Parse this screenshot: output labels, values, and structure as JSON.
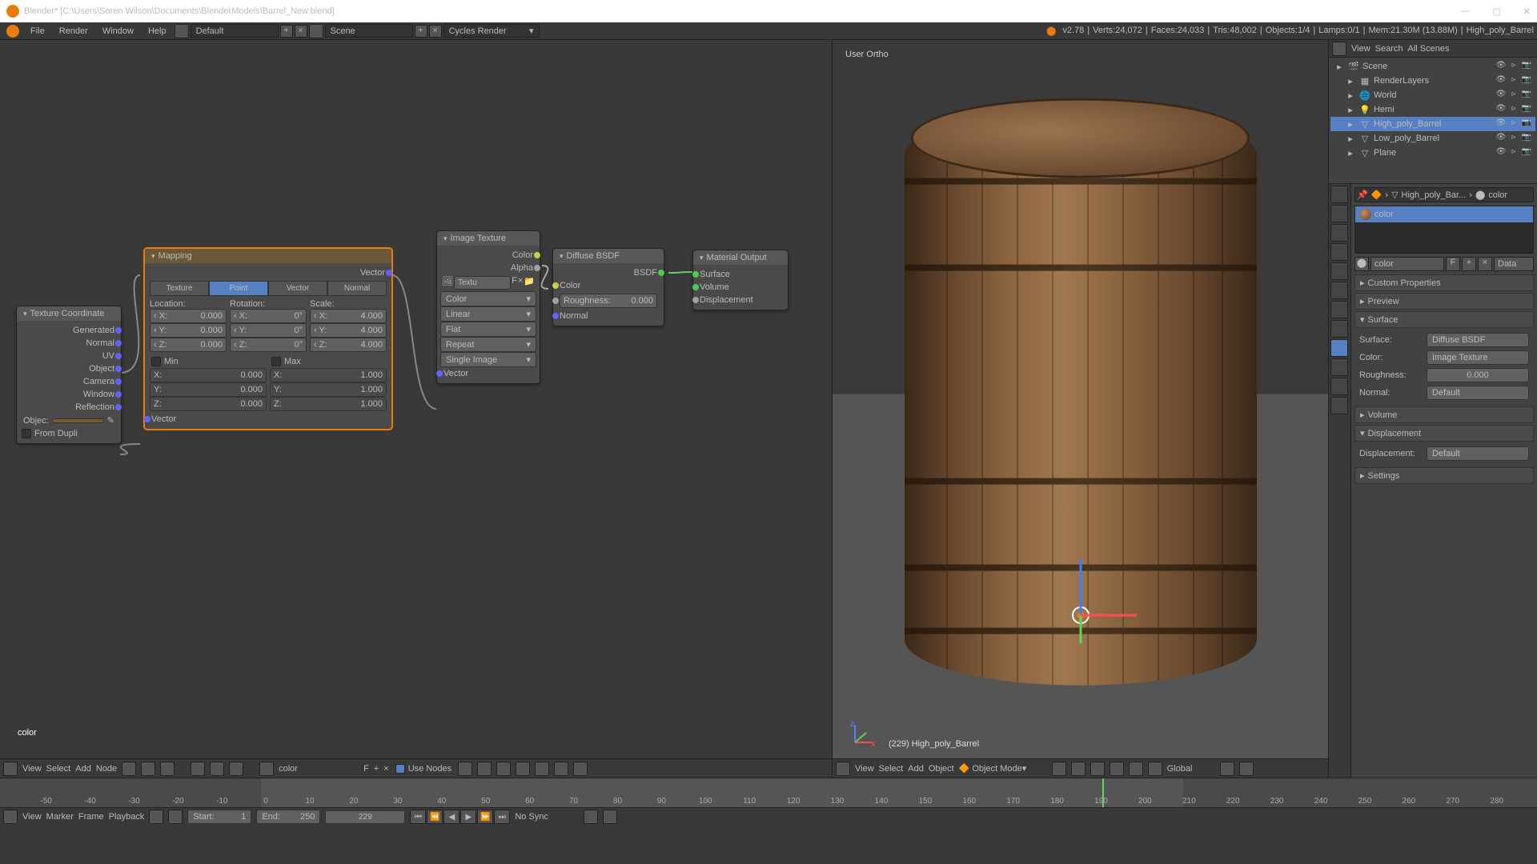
{
  "title": "Blender* [C:\\Users\\Soren Wilson\\Documents\\BlenderModels\\Barrel_New.blend]",
  "menubar": {
    "items": [
      "File",
      "Render",
      "Window",
      "Help"
    ],
    "layout": "Default",
    "scene": "Scene",
    "engine": "Cycles Render"
  },
  "stats": {
    "version": "v2.78",
    "verts": "Verts:24,072",
    "faces": "Faces:24,033",
    "tris": "Tris:48,002",
    "objects": "Objects:1/4",
    "lamps": "Lamps:0/1",
    "mem": "Mem:21.30M (13.88M)",
    "obj": "High_poly_Barrel"
  },
  "viewport": {
    "label": "User Ortho",
    "objlabel": "(229) High_poly_Barrel"
  },
  "vp_header": {
    "menus": [
      "View",
      "Select",
      "Add",
      "Object"
    ],
    "mode": "Object Mode",
    "orient": "Global"
  },
  "ne_header": {
    "menus": [
      "View",
      "Select",
      "Add",
      "Node"
    ],
    "matname": "color",
    "use_nodes": "Use Nodes"
  },
  "ne_matname": "color",
  "outliner": {
    "hdr": [
      "View",
      "Search",
      "All Scenes"
    ],
    "items": [
      {
        "label": "Scene",
        "icon": "scene",
        "indent": 0
      },
      {
        "label": "RenderLayers",
        "icon": "layers",
        "indent": 1
      },
      {
        "label": "World",
        "icon": "world",
        "indent": 1
      },
      {
        "label": "Hemi",
        "icon": "lamp",
        "indent": 1
      },
      {
        "label": "High_poly_Barrel",
        "icon": "mesh",
        "indent": 1,
        "sel": true
      },
      {
        "label": "Low_poly_Barrel",
        "icon": "mesh",
        "indent": 1
      },
      {
        "label": "Plane",
        "icon": "mesh",
        "indent": 1
      }
    ]
  },
  "props": {
    "breadcrumb": "High_poly_Bar...",
    "breadcrumb2": "color",
    "matname": "color",
    "data_btn": "Data",
    "f_btn": "F",
    "panels": [
      "Custom Properties",
      "Preview",
      "Surface",
      "Volume",
      "Displacement",
      "Settings"
    ],
    "surface": {
      "label": "Surface:",
      "surface": "Diffuse BSDF",
      "color_l": "Color:",
      "color": "Image Texture",
      "rough_l": "Roughness:",
      "rough": "0.000",
      "normal_l": "Normal:",
      "normal": "Default"
    },
    "displacement": {
      "label": "Displacement:",
      "val": "Default"
    }
  },
  "timeline": {
    "menus": [
      "View",
      "Marker",
      "Frame",
      "Playback"
    ],
    "start_l": "Start:",
    "start": "1",
    "end_l": "End:",
    "end": "250",
    "frame": "229",
    "sync": "No Sync",
    "ticks": [
      "-50",
      "-40",
      "-30",
      "-20",
      "-10",
      "0",
      "10",
      "20",
      "30",
      "40",
      "50",
      "60",
      "70",
      "80",
      "90",
      "100",
      "110",
      "120",
      "130",
      "140",
      "150",
      "160",
      "170",
      "180",
      "190",
      "200",
      "210",
      "220",
      "230",
      "240",
      "250",
      "260",
      "270",
      "280"
    ]
  },
  "nodes": {
    "texcoord": {
      "title": "Texture Coordinate",
      "outs": [
        "Generated",
        "Normal",
        "UV",
        "Object",
        "Camera",
        "Window",
        "Reflection"
      ],
      "objec": "Objec:",
      "from_dupli": "From Dupli"
    },
    "mapping": {
      "title": "Mapping",
      "out": "Vector",
      "tabs": [
        "Texture",
        "Point",
        "Vector",
        "Normal"
      ],
      "loc": "Location:",
      "rot": "Rotation:",
      "scale": "Scale:",
      "x": "X:",
      "y": "Y:",
      "z": "Z:",
      "locv": "0.000",
      "rotv": "0°",
      "scalev": "4.000",
      "min": "Min",
      "max": "Max",
      "minv": "0.000",
      "maxv": "1.000",
      "vector": "Vector"
    },
    "imgtex": {
      "title": "Image Texture",
      "color": "Color",
      "alpha": "Alpha",
      "img": "Textu",
      "f": "F",
      "colspace": "Color",
      "interp": "Linear",
      "proj": "Flat",
      "ext": "Repeat",
      "src": "Single Image",
      "vector": "Vector"
    },
    "diffuse": {
      "title": "Diffuse BSDF",
      "bsdf": "BSDF",
      "color": "Color",
      "rough_l": "Roughness:",
      "rough": "0.000",
      "normal": "Normal"
    },
    "output": {
      "title": "Material Output",
      "surface": "Surface",
      "volume": "Volume",
      "disp": "Displacement"
    }
  }
}
